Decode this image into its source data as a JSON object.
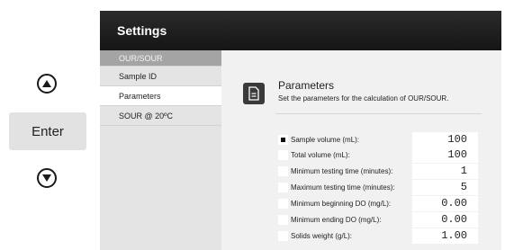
{
  "keys": {
    "enter_label": "Enter"
  },
  "header": {
    "title": "Settings"
  },
  "sidebar": {
    "items": [
      {
        "label": "OUR/SOUR",
        "state": "dim"
      },
      {
        "label": "Sample ID",
        "state": "normal"
      },
      {
        "label": "Parameters",
        "state": "active"
      },
      {
        "label": "SOUR @ 20ºC",
        "state": "normal"
      }
    ]
  },
  "main": {
    "icon": "document-icon",
    "heading": "Parameters",
    "subheading": "Set the parameters for the calculation of OUR/SOUR."
  },
  "parameters": [
    {
      "label": "Sample volume (mL):",
      "value": "100",
      "selected": true
    },
    {
      "label": "Total volume (mL):",
      "value": "100",
      "selected": false
    },
    {
      "label": "Minimum testing time (minutes):",
      "value": "1",
      "selected": false
    },
    {
      "label": "Maximum testing time (minutes):",
      "value": "5",
      "selected": false
    },
    {
      "label": "Minimum beginning DO (mg/L):",
      "value": "0.00",
      "selected": false
    },
    {
      "label": "Minimum ending DO (mg/L):",
      "value": "0.00",
      "selected": false
    },
    {
      "label": "Solids weight (g/L):",
      "value": "1.00",
      "selected": false
    }
  ],
  "colors": {
    "header": "#1f1f1f",
    "sidebar": "#e4e4e4",
    "content": "#f1f1f1"
  }
}
